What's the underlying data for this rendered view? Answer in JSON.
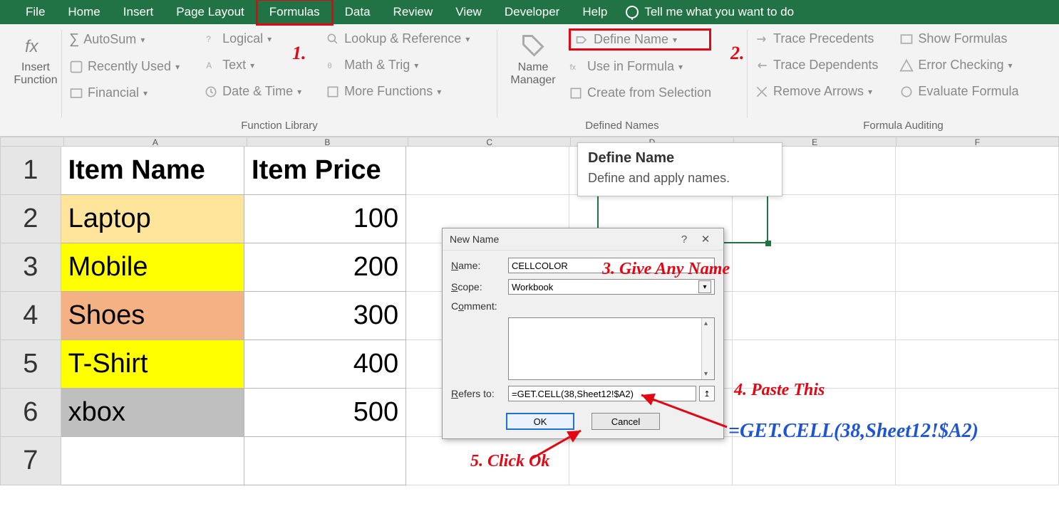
{
  "menu": {
    "items": [
      "File",
      "Home",
      "Insert",
      "Page Layout",
      "Formulas",
      "Data",
      "Review",
      "View",
      "Developer",
      "Help"
    ],
    "active_index": 4,
    "tell_me": "Tell me what you want to do"
  },
  "ribbon": {
    "insert_function": "Insert Function",
    "flib": {
      "autosum": "AutoSum",
      "recent": "Recently Used",
      "financial": "Financial",
      "logical": "Logical",
      "text": "Text",
      "datetime": "Date & Time",
      "lookup": "Lookup & Reference",
      "mathtrig": "Math & Trig",
      "more": "More Functions",
      "group_label": "Function Library"
    },
    "names": {
      "manager": "Name Manager",
      "define": "Define Name",
      "use": "Use in Formula",
      "create": "Create from Selection",
      "group_label": "Defined Names"
    },
    "audit": {
      "trace_p": "Trace Precedents",
      "trace_d": "Trace Dependents",
      "remove": "Remove Arrows",
      "show": "Show Formulas",
      "error": "Error Checking",
      "eval": "Evaluate Formula",
      "group_label": "Formula Auditing"
    }
  },
  "tooltip": {
    "title": "Define Name",
    "desc": "Define and apply names."
  },
  "grid": {
    "cols": [
      "A",
      "B",
      "C",
      "D",
      "E",
      "F"
    ],
    "rows": [
      {
        "n": "1",
        "a": "Item Name",
        "b": "Item Price",
        "a_bg": "#ffffff",
        "hdr": true
      },
      {
        "n": "2",
        "a": "Laptop",
        "b": "100",
        "a_bg": "#ffe49c"
      },
      {
        "n": "3",
        "a": "Mobile",
        "b": "200",
        "a_bg": "#ffff00"
      },
      {
        "n": "4",
        "a": "Shoes",
        "b": "300",
        "a_bg": "#f4b183"
      },
      {
        "n": "5",
        "a": "T-Shirt",
        "b": "400",
        "a_bg": "#ffff00"
      },
      {
        "n": "6",
        "a": "xbox",
        "b": "500",
        "a_bg": "#bfbfbf"
      },
      {
        "n": "7",
        "a": "",
        "b": "",
        "a_bg": "#ffffff"
      }
    ]
  },
  "dialog": {
    "title": "New Name",
    "name_label": "Name:",
    "name_value": "CELLCOLOR",
    "scope_label": "Scope:",
    "scope_value": "Workbook",
    "comment_label": "Comment:",
    "refers_label": "Refers to:",
    "refers_value": "=GET.CELL(38,Sheet12!$A2)",
    "ok": "OK",
    "cancel": "Cancel"
  },
  "annotations": {
    "n1": "1.",
    "n2": "2.",
    "n3": "3. Give Any Name",
    "n4": "4. Paste This",
    "n5": "5. Click Ok",
    "formula": "=GET.CELL(38,Sheet12!$A2)"
  }
}
